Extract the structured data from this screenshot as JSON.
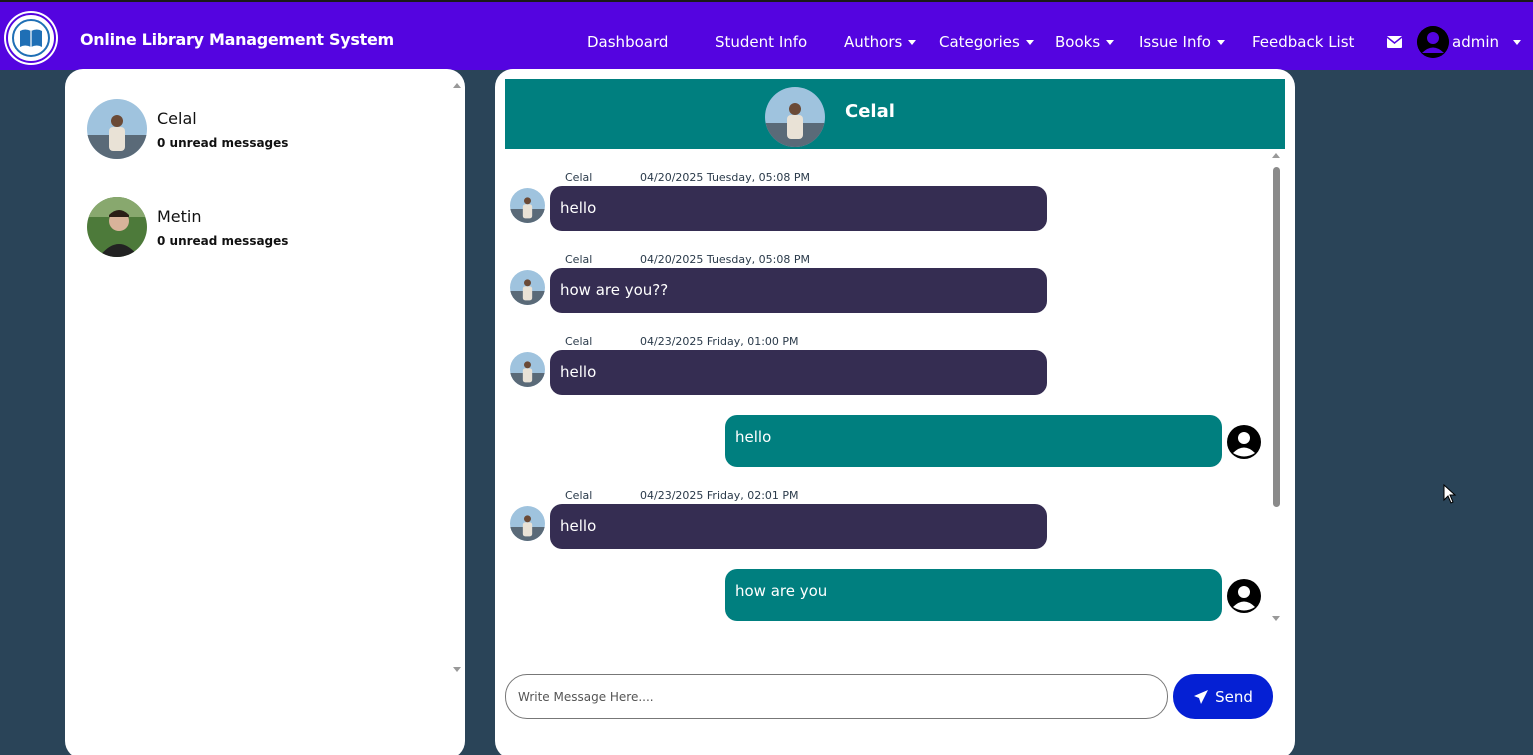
{
  "app": {
    "brand": "Online Library Management System",
    "accent_color": "#5404e0",
    "teal_color": "#007f7f",
    "bubble_dark_color": "#352d52"
  },
  "nav": {
    "dashboard": "Dashboard",
    "student_info": "Student Info",
    "authors": "Authors",
    "categories": "Categories",
    "books": "Books",
    "issue_info": "Issue Info",
    "feedback_list": "Feedback List",
    "user": "admin"
  },
  "contacts": [
    {
      "name": "Celal",
      "unread": "0 unread messages"
    },
    {
      "name": "Metin",
      "unread": "0 unread messages"
    }
  ],
  "chat": {
    "header_name": "Celal",
    "messages": [
      {
        "sender": "Celal",
        "time": "04/20/2025 Tuesday, 05:08 PM",
        "text": "hello"
      },
      {
        "sender": "Celal",
        "time": "04/20/2025 Tuesday, 05:08 PM",
        "text": "how are you??"
      },
      {
        "sender": "Celal",
        "time": "04/23/2025 Friday, 01:00 PM",
        "text": "hello"
      },
      {
        "sender": "admin",
        "time": "",
        "text": "hello"
      },
      {
        "sender": "Celal",
        "time": "04/23/2025 Friday, 02:01 PM",
        "text": "hello"
      },
      {
        "sender": "admin",
        "time": "",
        "text": "how are you"
      }
    ],
    "input_placeholder": "Write Message Here....",
    "send_label": "Send"
  }
}
